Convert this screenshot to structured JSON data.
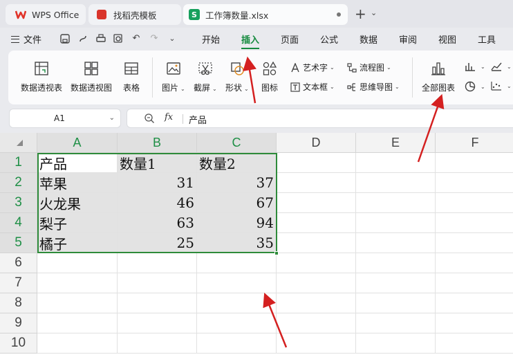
{
  "tabs": {
    "wps_office": "WPS Office",
    "template": "找稻壳模板",
    "workbook": "工作簿数量.xlsx"
  },
  "menubar": {
    "file": "文件",
    "tabs": [
      "开始",
      "插入",
      "页面",
      "公式",
      "数据",
      "审阅",
      "视图",
      "工具"
    ],
    "active": "插入"
  },
  "ribbon": {
    "pivot_table": "数据透视表",
    "pivot_chart": "数据透视图",
    "table": "表格",
    "picture": "图片",
    "screenshot": "截屏",
    "shape": "形状",
    "icon": "图标",
    "wordart": "艺术字",
    "textbox": "文本框",
    "flowchart": "流程图",
    "mindmap": "思维导图",
    "all_charts": "全部图表"
  },
  "formula_bar": {
    "name_box": "A1",
    "fx": "fx",
    "content": "产品"
  },
  "sheet": {
    "columns": [
      "A",
      "B",
      "C",
      "D",
      "E",
      "F"
    ],
    "rows": [
      "1",
      "2",
      "3",
      "4",
      "5",
      "6",
      "7",
      "8",
      "9",
      "10"
    ],
    "header": [
      "产品",
      "数量1",
      "数量2"
    ],
    "data": [
      [
        "苹果",
        "31",
        "37"
      ],
      [
        "火龙果",
        "46",
        "67"
      ],
      [
        "梨子",
        "63",
        "94"
      ],
      [
        "橘子",
        "25",
        "35"
      ]
    ]
  },
  "colors": {
    "accent": "#158a3e",
    "selection": "#2e8b3a",
    "annotation_arrow": "#d42020"
  }
}
